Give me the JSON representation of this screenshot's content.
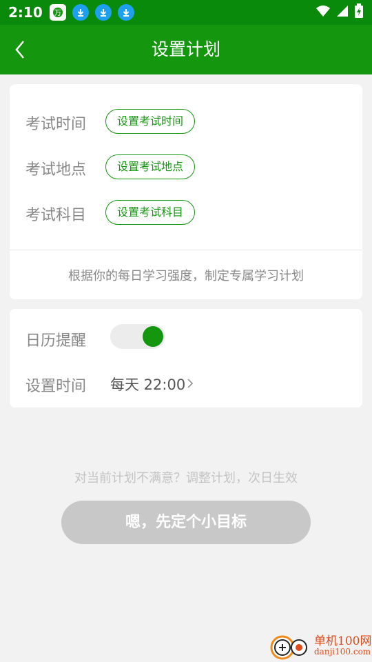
{
  "status_bar": {
    "time": "2:10",
    "icons": [
      "app-notification-icon",
      "download-icon",
      "download-icon",
      "download-icon",
      "wifi-icon",
      "signal-icon",
      "battery-charging-icon"
    ]
  },
  "app_bar": {
    "back_icon": "chevron-left-icon",
    "title": "设置计划"
  },
  "exam_card": {
    "rows": [
      {
        "label": "考试时间",
        "button": "设置考试时间"
      },
      {
        "label": "考试地点",
        "button": "设置考试地点"
      },
      {
        "label": "考试科目",
        "button": "设置考试科目"
      }
    ],
    "hint": "根据你的每日学习强度，制定专属学习计划"
  },
  "reminder_card": {
    "calendar_label": "日历提醒",
    "calendar_enabled": true,
    "time_label": "设置时间",
    "time_value": "每天 22:00"
  },
  "footer": {
    "hint": "对当前计划不满意？调整计划，次日生效",
    "confirm_button": "嗯，先定个小目标"
  },
  "watermark": {
    "brand": "单机100网",
    "domain": "danji100.com"
  },
  "colors": {
    "status_bar": "#0a8a0a",
    "app_bar": "#14960f",
    "accent": "#14960f",
    "background": "#f2f2f2",
    "disabled_button": "#c8c8c8"
  }
}
